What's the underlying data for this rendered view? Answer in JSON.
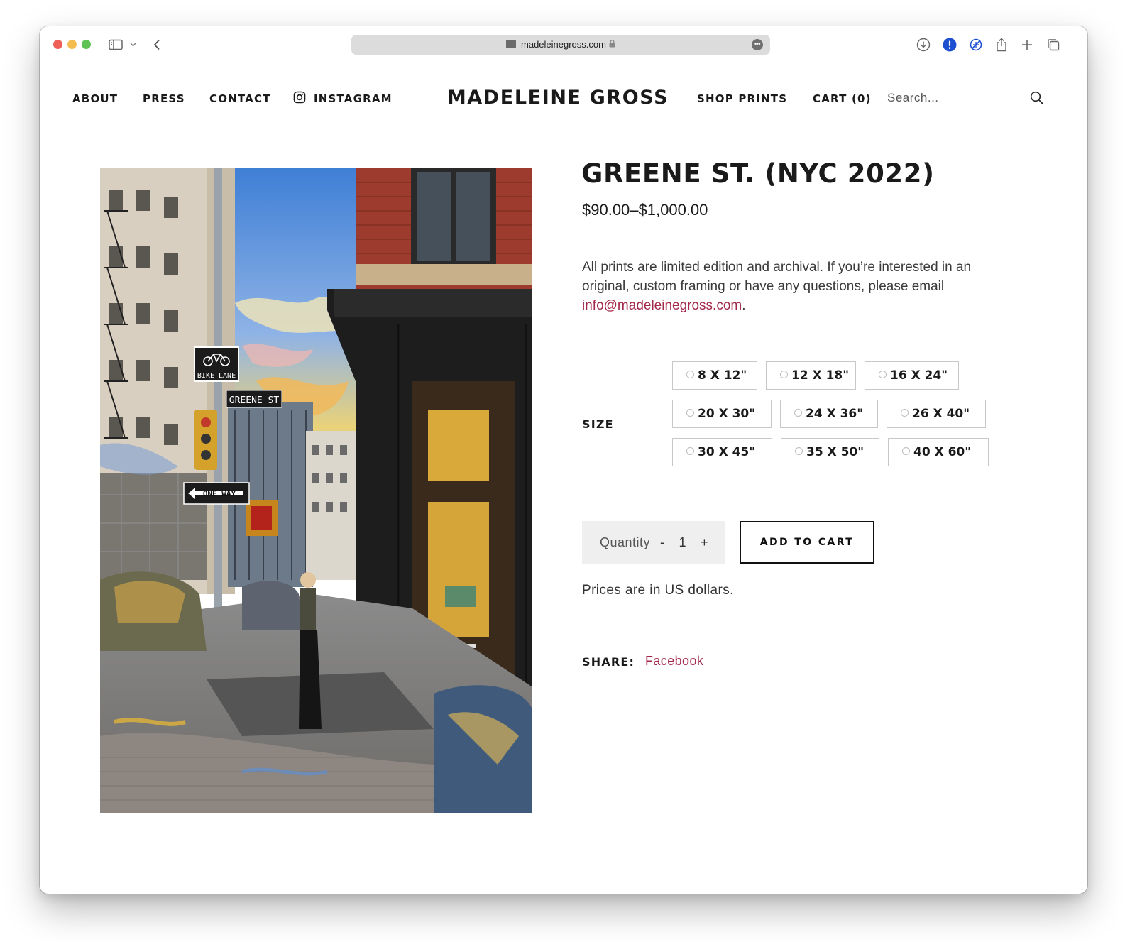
{
  "browser": {
    "url_display": "madeleinegross.com",
    "more_label": "•••"
  },
  "header": {
    "nav_left": [
      "ABOUT",
      "PRESS",
      "CONTACT",
      "INSTAGRAM"
    ],
    "brand": "MADELEINE GROSS",
    "shop_prints": "SHOP PRINTS",
    "cart_label": "CART (0)",
    "search_placeholder": "Search..."
  },
  "product": {
    "title": "GREENE ST. (NYC 2022)",
    "price_range": "$90.00–$1,000.00",
    "description": "All prints are limited edition and archival. If you’re interested in an original, custom framing or have any questions, please email ",
    "email": "info@madeleinegross.com",
    "description_end": ".",
    "size_label": "SIZE",
    "sizes": [
      "8 X 12\"",
      "12 X 18\"",
      "16 X 24\"",
      "20 X 30\"",
      "24 X 36\"",
      "26 X 40\"",
      "30 X 45\"",
      "35 X 50\"",
      "40 X 60\""
    ],
    "quantity_label": "Quantity",
    "quantity_minus": "-",
    "quantity_value": "1",
    "quantity_plus": "+",
    "add_to_cart": "ADD TO CART",
    "currency_note": "Prices are in US dollars.",
    "share_label": "SHARE:",
    "share_facebook": "Facebook",
    "image_signs": [
      "BIKE LANE",
      "GREENE ST",
      "ONE WAY"
    ]
  },
  "colors": {
    "accent_link": "#a3294a",
    "text": "#1a1a1a"
  },
  "icons": [
    "sidebar-icon",
    "chevron-down-icon",
    "back-chevron-icon",
    "lock-icon",
    "download-icon",
    "alert-icon",
    "vpn-icon",
    "share-icon",
    "plus-icon",
    "tabs-icon",
    "instagram-icon",
    "search-icon",
    "bicycle-icon",
    "arrow-left-icon"
  ]
}
